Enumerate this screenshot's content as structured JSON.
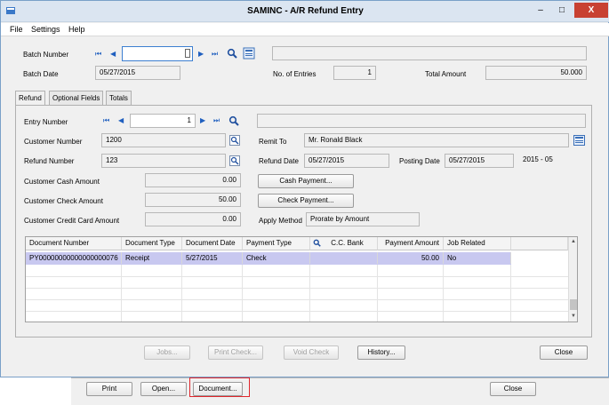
{
  "window": {
    "title": "SAMINC - A/R Refund Entry",
    "btn_min": "–",
    "btn_max": "□",
    "btn_close": "X"
  },
  "menu": [
    "File",
    "Settings",
    "Help"
  ],
  "batch": {
    "number_label": "Batch Number",
    "number_value": "",
    "date_label": "Batch Date",
    "date_value": "05/27/2015",
    "description_value": "",
    "entries_label": "No. of Entries",
    "entries_value": "1",
    "total_label": "Total Amount",
    "total_value": "50.000"
  },
  "tabs": [
    "Refund",
    "Optional Fields",
    "Totals"
  ],
  "entry": {
    "number_label": "Entry Number",
    "number_value": "1",
    "description_value": "",
    "customer_number_label": "Customer Number",
    "customer_number_value": "1200",
    "remit_to_label": "Remit To",
    "remit_to_value": "Mr. Ronald Black",
    "refund_number_label": "Refund Number",
    "refund_number_value": "123",
    "refund_date_label": "Refund Date",
    "refund_date_value": "05/27/2015",
    "posting_date_label": "Posting Date",
    "posting_date_value": "05/27/2015",
    "period_value": "2015 - 05",
    "cash_label": "Customer Cash Amount",
    "cash_value": "0.00",
    "cash_payment_button": "Cash Payment...",
    "check_label": "Customer Check Amount",
    "check_value": "50.00",
    "check_payment_button": "Check Payment...",
    "credit_label": "Customer Credit Card Amount",
    "credit_value": "0.00",
    "apply_method_label": "Apply Method",
    "apply_method_value": "Prorate by Amount"
  },
  "grid": {
    "headers": [
      "Document Number",
      "Document Type",
      "Document Date",
      "Payment Type",
      "C.C. Bank",
      "Payment Amount",
      "Job Related"
    ],
    "rows": [
      [
        "PY00000000000000000076",
        "Receipt",
        "5/27/2015",
        "Check",
        "",
        "50.00",
        "No"
      ]
    ]
  },
  "bottom_buttons": {
    "jobs": "Jobs...",
    "print_check": "Print Check...",
    "void_check": "Void Check",
    "history": "History...",
    "close": "Close"
  },
  "behind_window": {
    "print": "Print",
    "open": "Open...",
    "document": "Document...",
    "close": "Close"
  },
  "colors": {
    "title_bar": "#dbe5f1",
    "close_button": "#c84132",
    "selected_row": "#c8c8f0",
    "highlight_border": "#e0262b"
  }
}
